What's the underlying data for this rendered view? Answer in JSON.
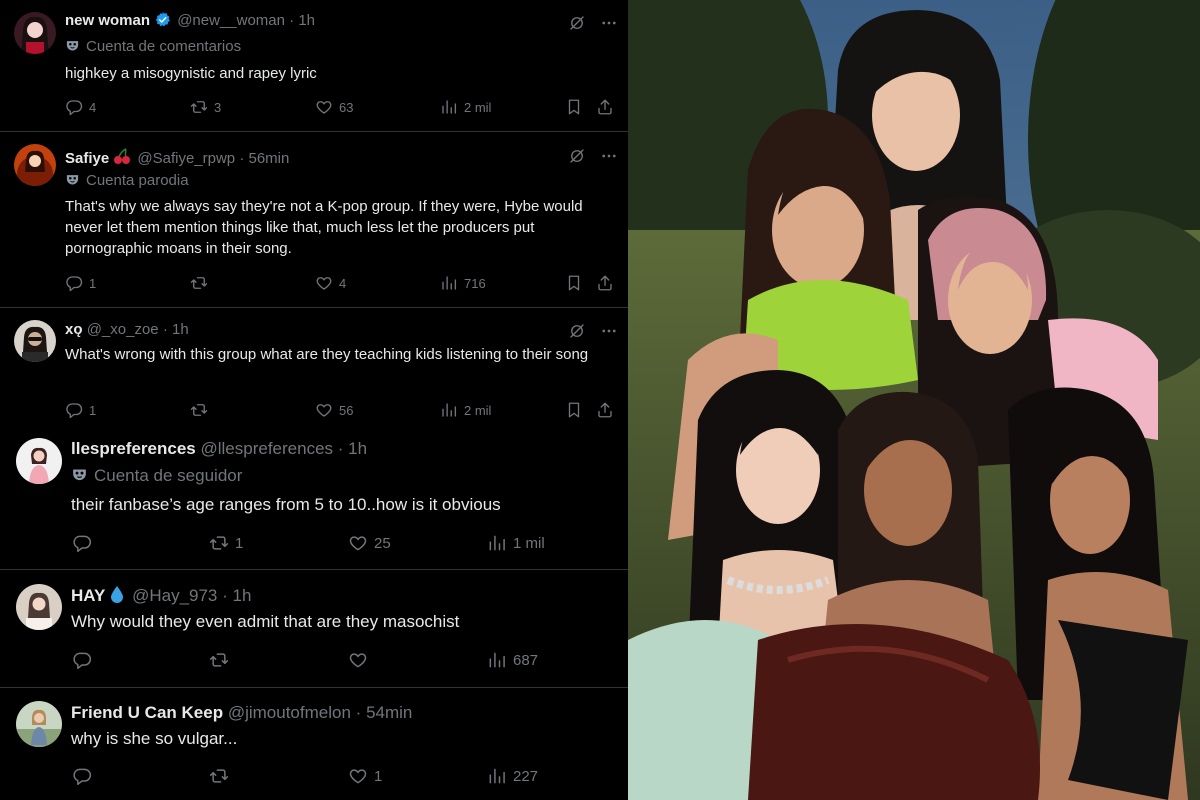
{
  "tweets": [
    {
      "name": "new woman",
      "verified": true,
      "handle": "@new__woman",
      "time": "1h",
      "label": "Cuenta de comentarios",
      "text": "highkey a misogynistic and rapey lyric",
      "replies": "4",
      "retweets": "3",
      "likes": "63",
      "views": "2 mil"
    },
    {
      "name": "Safiye",
      "emoji": "cherries",
      "handle": "@Safiye_rpwp",
      "time": "56min",
      "label": "Cuenta parodia",
      "text": "That's why we always say they're not a K-pop group. If they were, Hybe would never let them mention things like that, much less let the producers put pornographic moans in their song.",
      "replies": "1",
      "retweets": "",
      "likes": "4",
      "views": "716"
    },
    {
      "name": "xǫ",
      "handle": "@_xo_zoe",
      "time": "1h",
      "text": "What's wrong with this group what are they teaching kids listening to their song",
      "replies": "1",
      "retweets": "",
      "likes": "56",
      "views": "2 mil"
    },
    {
      "name": "llespreferences",
      "handle": "@llespreferences",
      "time": "1h",
      "label": "Cuenta de seguidor",
      "text": "their fanbase’s age ranges from 5 to 10..how is it obvious",
      "replies": "",
      "retweets": "1",
      "likes": "25",
      "views": "1 mil"
    },
    {
      "name": "HAY",
      "emoji": "droplet",
      "handle": "@Hay_973",
      "time": "1h",
      "text": "Why would they even admit that are they masochist",
      "replies": "",
      "retweets": "",
      "likes": "",
      "views": "687"
    },
    {
      "name": "Friend U Can Keep",
      "handle": "@jimoutofmelon",
      "time": "54min",
      "text": "why is she so vulgar...",
      "replies": "",
      "retweets": "",
      "likes": "1",
      "views": "227"
    }
  ],
  "separator": "·",
  "colors": {
    "background": "#000000",
    "text": "#e7e9ea",
    "muted": "#71767b",
    "divider": "#2f3336",
    "verified": "#1d9bf0"
  },
  "icons": [
    "verified-badge-icon",
    "grok-icon",
    "more-icon",
    "reply-icon",
    "retweet-icon",
    "like-icon",
    "views-icon",
    "bookmark-icon",
    "share-icon",
    "parody-mask-icon"
  ]
}
